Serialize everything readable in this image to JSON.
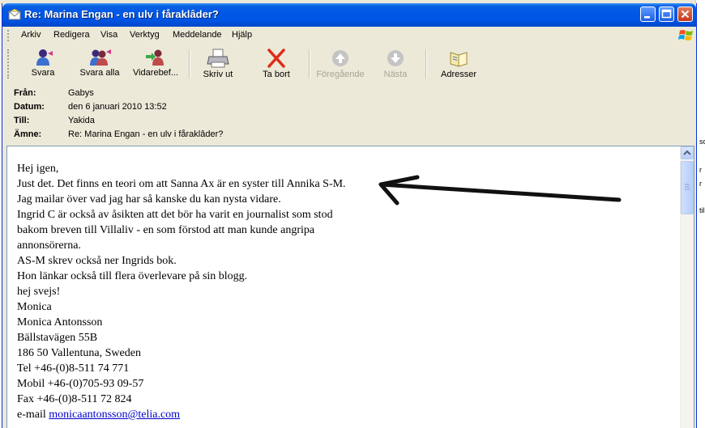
{
  "window": {
    "title": "Re: Marina Engan - en ulv i fåraklâder?"
  },
  "menu": [
    "Arkiv",
    "Redigera",
    "Visa",
    "Verktyg",
    "Meddelande",
    "Hjälp"
  ],
  "toolbar": {
    "reply": "Svara",
    "reply_all": "Svara alla",
    "forward": "Vidarebef...",
    "print": "Skriv ut",
    "delete": "Ta bort",
    "previous": "Föregående",
    "next": "Nästa",
    "addresses": "Adresser"
  },
  "header": {
    "from_label": "Från:",
    "from": "Gabys",
    "date_label": "Datum:",
    "date": "den 6 januari 2010 13:52",
    "to_label": "Till:",
    "to": "Yakida",
    "subject_label": "Ämne:",
    "subject": "Re: Marina Engan - en ulv i fåraklâder?"
  },
  "body": {
    "lines": [
      "Hej igen,",
      "Just det. Det finns en teori om att Sanna Ax är en syster till Annika S-M.",
      "Jag mailar över vad jag har så kanske du kan nysta vidare.",
      "Ingrid C är också av åsikten att det bör ha varit en journalist som stod",
      "bakom breven till Villaliv - en som förstod att man kunde angripa",
      "annonsörerna.",
      "AS-M skrev också ner Ingrids bok.",
      "Hon länkar också till flera överlevare på sin blogg.",
      "hej svejs!",
      "Monica",
      "Monica Antonsson",
      "Bällstavägen 55B",
      "186 50  Vallentuna, Sweden",
      "Tel +46-(0)8-511 74 771",
      "Mobil +46-(0)705-93 09-57",
      "Fax +46-(0)8-511 72 824"
    ],
    "email_prefix": "e-mail ",
    "email_link": "monicaantonsson@telia.com"
  },
  "background_fragments": [
    "sc",
    "r",
    "r",
    "til"
  ],
  "colors": {
    "titlebar": "#0055e5",
    "chrome": "#ece9d8",
    "link": "#0000cc",
    "annotation_arrow": "#111111"
  },
  "icons": [
    "envelope-icon",
    "reply-icon",
    "reply-all-icon",
    "forward-icon",
    "printer-icon",
    "delete-x-icon",
    "up-arrow-icon",
    "down-arrow-icon",
    "address-book-icon",
    "windows-logo-icon"
  ]
}
